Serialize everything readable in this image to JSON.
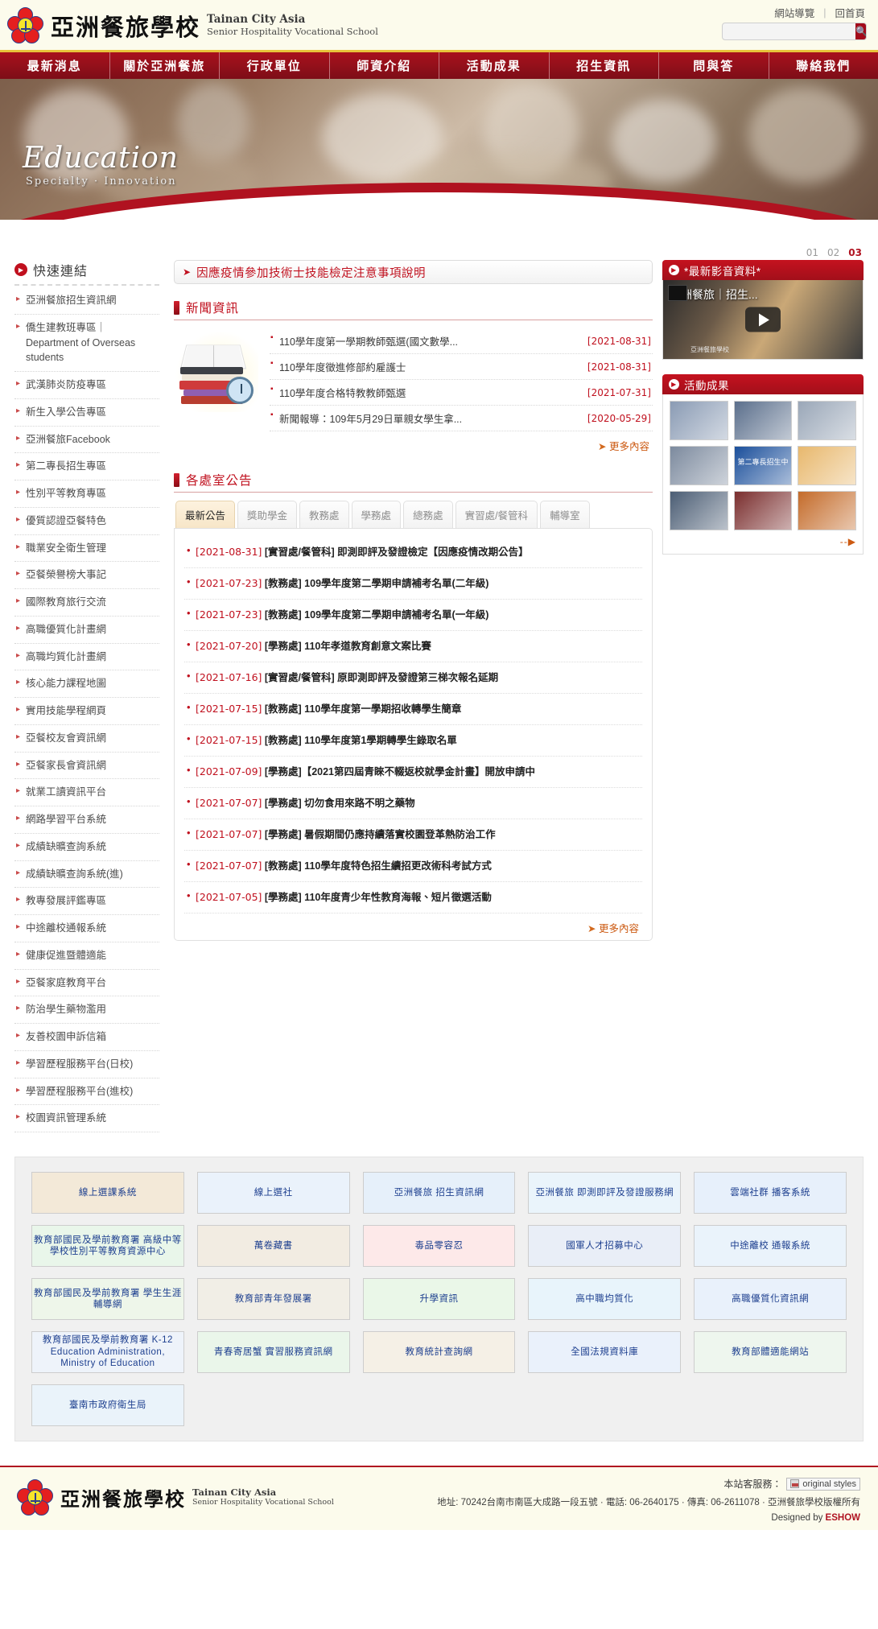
{
  "header": {
    "school_name_cn": "亞洲餐旅學校",
    "school_name_en_line1": "Tainan City Asia",
    "school_name_en_line2": "Senior Hospitality Vocational School",
    "util_links": [
      "網站導覽",
      "回首頁"
    ],
    "util_separator": "|",
    "search_placeholder": "",
    "search_value": "",
    "search_icon": "search-icon"
  },
  "nav": {
    "items": [
      "最新消息",
      "關於亞洲餐旅",
      "行政單位",
      "師資介紹",
      "活動成果",
      "招生資訊",
      "問與答",
      "聯絡我們"
    ]
  },
  "banner": {
    "headline": "Education",
    "subline": "Specialty · Innovation",
    "slides": [
      "01",
      "02",
      "03"
    ],
    "active_slide": "03"
  },
  "quick_links": {
    "title": "快速連結",
    "items": [
      "亞洲餐旅招生資訊網",
      "僑生建教班專區｜Department of Overseas students",
      "武漢肺炎防疫專區",
      "新生入學公告專區",
      "亞洲餐旅Facebook",
      "第二專長招生專區",
      "性別平等教育專區",
      "優質認證亞餐特色",
      "職業安全衛生管理",
      "亞餐榮譽榜大事記",
      "國際教育旅行交流",
      "高職優質化計畫網",
      "高職均質化計畫網",
      "核心能力課程地圖",
      "實用技能學程網頁",
      "亞餐校友會資訊網",
      "亞餐家長會資訊網",
      "就業工讀資訊平台",
      "網路學習平台系統",
      "成績缺曠查詢系統",
      "成績缺曠查詢系統(進)",
      "教專發展評鑑專區",
      "中途離校通報系統",
      "健康促進暨體適能",
      "亞餐家庭教育平台",
      "防治學生藥物濫用",
      "友善校園申訴信箱",
      "學習歷程服務平台(日校)",
      "學習歷程服務平台(進校)",
      "校園資訊管理系統"
    ]
  },
  "notice": {
    "text": "因應疫情參加技術士技能檢定注意事項說明"
  },
  "news": {
    "title": "新聞資訊",
    "more_label": "更多內容",
    "items": [
      {
        "title": "110學年度第一學期教師甄選(國文數學...",
        "date": "[2021-08-31]"
      },
      {
        "title": "110學年度徵進修部約雇護士",
        "date": "[2021-08-31]"
      },
      {
        "title": "110學年度合格特教教師甄選",
        "date": "[2021-07-31]"
      },
      {
        "title": "新聞報導：109年5月29日單親女學生拿...",
        "date": "[2020-05-29]"
      }
    ]
  },
  "announcements": {
    "title": "各處室公告",
    "more_label": "更多內容",
    "tabs": [
      "最新公告",
      "獎助學金",
      "教務處",
      "學務處",
      "總務處",
      "實習處/餐管科",
      "輔導室"
    ],
    "active_tab": "最新公告",
    "items": [
      {
        "date": "[2021-08-31]",
        "text": "[實習處/餐管科] 即測即評及發證檢定【因應疫情改期公告】"
      },
      {
        "date": "[2021-07-23]",
        "text": "[教務處] 109學年度第二學期申請補考名單(二年級)"
      },
      {
        "date": "[2021-07-23]",
        "text": "[教務處] 109學年度第二學期申請補考名單(一年級)"
      },
      {
        "date": "[2021-07-20]",
        "text": "[學務處] 110年孝道教育創意文案比賽"
      },
      {
        "date": "[2021-07-16]",
        "text": "[實習處/餐管科] 原即測即評及發證第三梯次報名延期"
      },
      {
        "date": "[2021-07-15]",
        "text": "[教務處] 110學年度第一學期招收轉學生簡章"
      },
      {
        "date": "[2021-07-15]",
        "text": "[教務處] 110學年度第1學期轉學生錄取名單"
      },
      {
        "date": "[2021-07-09]",
        "text": "[學務處]【2021第四屆青睞不輟返校就學金計畫】開放申請中"
      },
      {
        "date": "[2021-07-07]",
        "text": "[學務處] 切勿食用來路不明之藥物"
      },
      {
        "date": "[2021-07-07]",
        "text": "[學務處] 暑假期間仍應持續落實校園登革熱防治工作"
      },
      {
        "date": "[2021-07-07]",
        "text": "[教務處] 110學年度特色招生續招更改術科考試方式"
      },
      {
        "date": "[2021-07-05]",
        "text": "[學務處] 110年度青少年性教育海報、短片徵選活動"
      }
    ]
  },
  "video_panel": {
    "title": "*最新影音資料*",
    "video_title": "亞洲餐旅｜招生...",
    "video_caption": "亞洲餐旅學校",
    "play_icon": "play-icon"
  },
  "gallery_panel": {
    "title": "活動成果",
    "more_label": "--▶",
    "cells": [
      {
        "label": "",
        "color": "#8a9bb4"
      },
      {
        "label": "",
        "color": "#5b6f8c"
      },
      {
        "label": "",
        "color": "#9aa7b8"
      },
      {
        "label": "",
        "color": "#7c8a9e"
      },
      {
        "label": "第二專長招生中",
        "color": "#1b4f9b"
      },
      {
        "label": "",
        "color": "#e8b86d"
      },
      {
        "label": "",
        "color": "#4b5d74"
      },
      {
        "label": "",
        "color": "#7a2e2e"
      },
      {
        "label": "",
        "color": "#c46b2a"
      }
    ]
  },
  "partners": {
    "items": [
      "線上選課系統",
      "線上選社",
      "亞洲餐旅 招生資訊網",
      "亞洲餐旅 即測即評及發證服務網",
      "雲端社群 播客系統",
      "教育部國民及學前教育署 高級中等學校性別平等教育資源中心",
      "萬卷藏書",
      "毒品零容忍",
      "國軍人才招募中心",
      "中途離校 通報系統",
      "教育部國民及學前教育署 學生生涯輔導網",
      "教育部青年發展署",
      "升學資訊",
      "高中職均質化",
      "高職優質化資訊網",
      "教育部國民及學前教育署 K-12 Education Administration, Ministry of Education",
      "青春寄居蟹 實習服務資訊網",
      "教育統計查詢網",
      "全國法規資料庫",
      "教育部體適能網站",
      "臺南市政府衛生局"
    ]
  },
  "footer": {
    "school_name_cn": "亞洲餐旅學校",
    "school_name_en_line1": "Tainan City Asia",
    "school_name_en_line2": "Senior Hospitality Vocational School",
    "customer_service_label": "本站客服務：",
    "customer_service_image_alt": "original styles",
    "address": "地址: 70242台南市南區大成路一段五號 · 電話: 06-2640175 · 傳真: 06-2611078 · 亞洲餐旅學校版權所有",
    "designed_prefix": "Designed by ",
    "designed_by": "ESHOW"
  }
}
